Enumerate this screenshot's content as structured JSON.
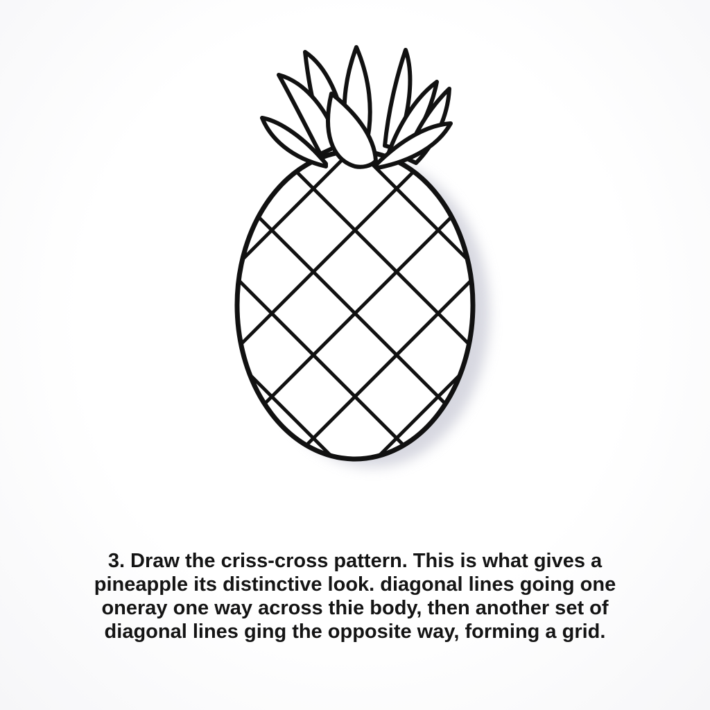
{
  "illustration": {
    "subject_icon": "pineapple-icon",
    "stroke_color": "#111111",
    "fill_color": "#ffffff",
    "shadow_color": "#c9cad6"
  },
  "caption": {
    "lines": [
      "3. Draw the criss-cross pattern. This is what gives a",
      "pineapple its distinctive look. diagonal lines going one",
      "oneray one way across thie body, then another set of",
      "diagonal lines ging the opposite way, forming a grid."
    ]
  }
}
